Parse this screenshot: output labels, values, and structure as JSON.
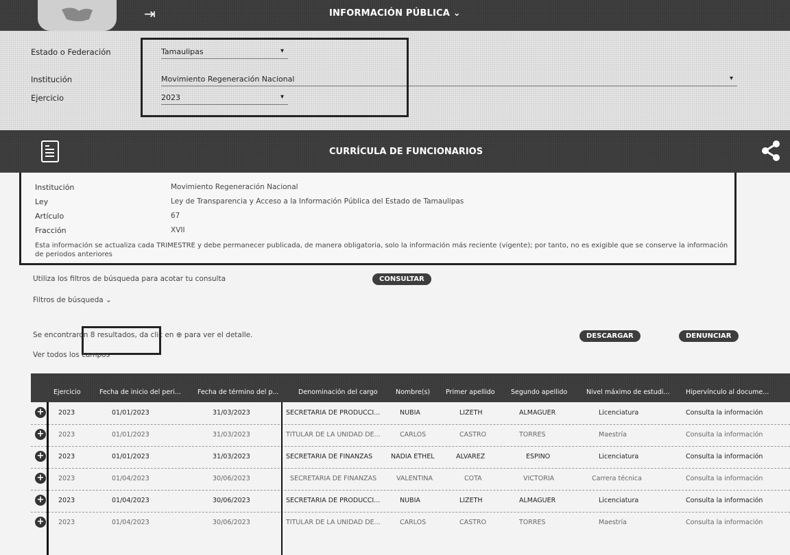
{
  "topbar": {
    "title": "INFORMACIÓN PÚBLICA ⌄"
  },
  "filters": {
    "estado_label": "Estado o Federación",
    "estado_value": "Tamaulipas",
    "institucion_label": "Institución",
    "institucion_value": "Movimiento Regeneración Nacional",
    "ejercicio_label": "Ejercicio",
    "ejercicio_value": "2023"
  },
  "section": {
    "title": "CURRÍCULA DE FUNCIONARIOS"
  },
  "info": {
    "institucion_label": "Institución",
    "institucion_value": "Movimiento Regeneración Nacional",
    "ley_label": "Ley",
    "ley_value": "Ley de Transparencia y Acceso a la Información Pública del Estado de Tamaulipas",
    "articulo_label": "Artículo",
    "articulo_value": "67",
    "fraccion_label": "Fracción",
    "fraccion_value": "XVII",
    "note": "Esta información se actualiza cada TRIMESTRE y debe permanecer publicada, de manera obligatoria, solo la información más reciente (vigente); por tanto, no es exigible que se conserve la información de periodos anteriores"
  },
  "search": {
    "hint": "Utiliza los filtros de búsqueda para acotar tu consulta",
    "consult_button": "CONSULTAR",
    "filters_toggle": "Filtros de búsqueda ⌄",
    "results_text": "Se encontraron 8 resultados, da clic en ⊕ para ver el detalle.",
    "show_all": "Ver todos los campos",
    "download_button": "DESCARGAR",
    "report_button": "DENUNCIAR"
  },
  "table": {
    "headers": [
      "Ejercicio",
      "Fecha de inicio del peri...",
      "Fecha de término del p...",
      "Denominación del cargo",
      "Nombre(s)",
      "Primer apellido",
      "Segundo apellido",
      "Nivel máximo de estudi...",
      "Hipervínculo al docume..."
    ],
    "rows": [
      [
        "2023",
        "01/01/2023",
        "31/03/2023",
        "SECRETARIA DE PRODUCCI...",
        "NUBIA",
        "LIZETH",
        "ALMAGUER",
        "Licenciatura",
        "Consulta la información"
      ],
      [
        "2023",
        "01/01/2023",
        "31/03/2023",
        "TITULAR DE LA UNIDAD DE...",
        "CARLOS",
        "CASTRO",
        "TORRES",
        "Maestría",
        "Consulta la información"
      ],
      [
        "2023",
        "01/01/2023",
        "31/03/2023",
        "SECRETARIA DE FINANZAS",
        "NADIA ETHEL",
        "ALVAREZ",
        "ESPINO",
        "Licenciatura",
        "Consulta la información"
      ],
      [
        "2023",
        "01/04/2023",
        "30/06/2023",
        "SECRETARIA DE FINANZAS",
        "VALENTINA",
        "COTA",
        "VICTORIA",
        "Carrera técnica",
        "Consulta la información"
      ],
      [
        "2023",
        "01/04/2023",
        "30/06/2023",
        "SECRETARIA DE PRODUCCI...",
        "NUBIA",
        "LIZETH",
        "ALMAGUER",
        "Licenciatura",
        "Consulta la información"
      ],
      [
        "2023",
        "01/04/2023",
        "30/06/2023",
        "TITULAR DE LA UNIDAD DE...",
        "CARLOS",
        "CASTRO",
        "TORRES",
        "Maestría",
        "Consulta la información"
      ]
    ]
  }
}
